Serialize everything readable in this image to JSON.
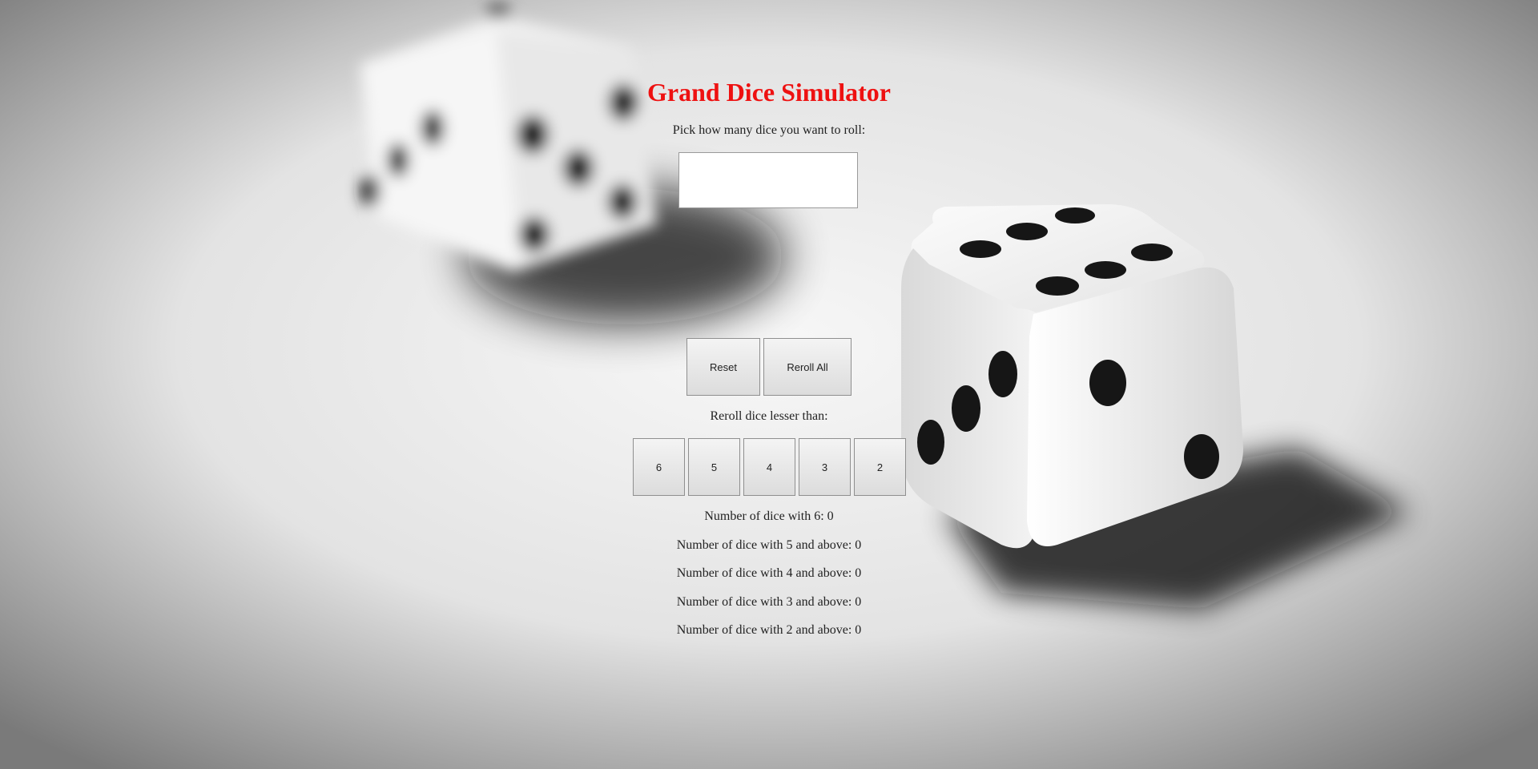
{
  "app": {
    "title": "Grand Dice Simulator",
    "prompt": "Pick how many dice you want to roll:",
    "dice_count_value": "",
    "title_color": "#ee1111"
  },
  "controls": {
    "reset_label": "Reset",
    "reroll_all_label": "Reroll All"
  },
  "reroll": {
    "label": "Reroll dice lesser than:",
    "thresholds": [
      "6",
      "5",
      "4",
      "3",
      "2"
    ]
  },
  "stats": [
    {
      "label": "Number of dice with 6:",
      "value": "0"
    },
    {
      "label": "Number of dice with 5 and above:",
      "value": "0"
    },
    {
      "label": "Number of dice with 4 and above:",
      "value": "0"
    },
    {
      "label": "Number of dice with 3 and above:",
      "value": "0"
    },
    {
      "label": "Number of dice with 2 and above:",
      "value": "0"
    }
  ],
  "background": {
    "description_icon": "dice-photo-background"
  }
}
